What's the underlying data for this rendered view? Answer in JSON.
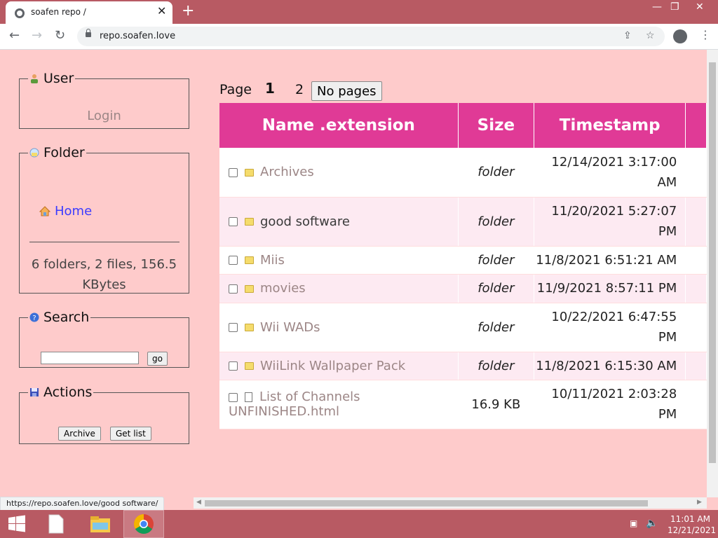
{
  "browser": {
    "tab_title": "soafen repo /",
    "url": "repo.soafen.love",
    "status_url": "https://repo.soafen.love/good software/"
  },
  "sidebar": {
    "user": {
      "legend": "User",
      "login_label": "Login"
    },
    "folder": {
      "legend": "Folder",
      "home_label": "Home",
      "stats": "6 folders, 2 files, 156.5 KBytes"
    },
    "search": {
      "legend": "Search",
      "input_value": "",
      "go_label": "go"
    },
    "actions": {
      "legend": "Actions",
      "archive_label": "Archive",
      "getlist_label": "Get list"
    }
  },
  "pager": {
    "label": "Page",
    "pages": [
      "1",
      "2"
    ],
    "current": "1",
    "no_pages_label": "No pages"
  },
  "table": {
    "headers": [
      "Name .extension",
      "Size",
      "Timestamp"
    ],
    "rows": [
      {
        "name": "Archives",
        "type": "folder",
        "size": "folder",
        "timestamp": "12/14/2021 3:17:00 AM"
      },
      {
        "name": "good software",
        "type": "folder",
        "size": "folder",
        "timestamp": "11/20/2021 5:27:07 PM"
      },
      {
        "name": "Miis",
        "type": "folder",
        "size": "folder",
        "timestamp": "11/8/2021 6:51:21 AM"
      },
      {
        "name": "movies",
        "type": "folder",
        "size": "folder",
        "timestamp": "11/9/2021 8:57:11 PM"
      },
      {
        "name": "Wii WADs",
        "type": "folder",
        "size": "folder",
        "timestamp": "10/22/2021 6:47:55 PM"
      },
      {
        "name": "WiiLink Wallpaper Pack",
        "type": "folder",
        "size": "folder",
        "timestamp": "11/8/2021 6:15:30 AM"
      },
      {
        "name": "List of Channels UNFINISHED.html",
        "type": "file",
        "size": "16.9 KB",
        "timestamp": "10/11/2021 2:03:28 PM"
      }
    ]
  },
  "taskbar": {
    "time": "11:01 AM",
    "date": "12/21/2021"
  }
}
